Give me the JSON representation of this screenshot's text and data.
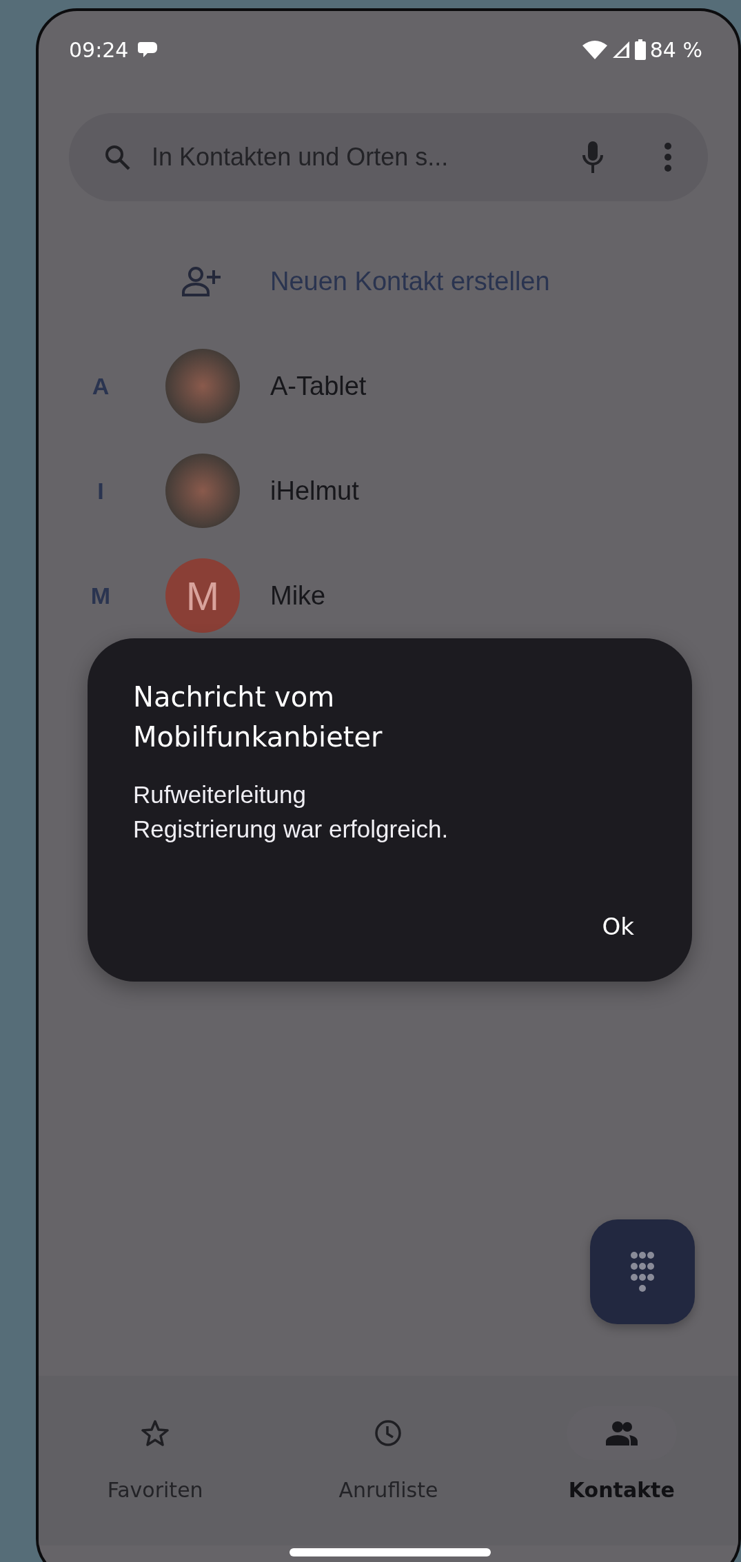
{
  "status_bar": {
    "time": "09:24",
    "battery": "84 %"
  },
  "search": {
    "placeholder": "In Kontakten und Orten s..."
  },
  "new_contact": {
    "label": "Neuen Kontakt erstellen"
  },
  "contacts": [
    {
      "letter": "A",
      "name": "A-Tablet",
      "avatar": {
        "kind": "photo"
      }
    },
    {
      "letter": "I",
      "name": "iHelmut",
      "avatar": {
        "kind": "photo"
      }
    },
    {
      "letter": "M",
      "name": "Mike",
      "avatar": {
        "kind": "letter",
        "text": "M",
        "color": "#8a3f36"
      }
    }
  ],
  "dialog": {
    "title": "Nachricht vom Mobilfunkanbieter",
    "body_lines": [
      "Rufweiterleitung",
      "Registrierung war erfolgreich."
    ],
    "button": "Ok"
  },
  "bottom_nav": [
    {
      "label": "Favoriten",
      "selected": false
    },
    {
      "label": "Anrufliste",
      "selected": false
    },
    {
      "label": "Kontakte",
      "selected": true
    }
  ]
}
